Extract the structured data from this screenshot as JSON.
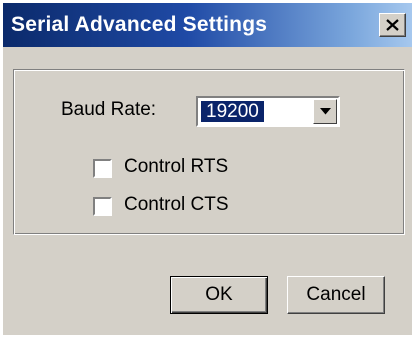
{
  "window": {
    "title": "Serial Advanced Settings",
    "close_glyph": "X"
  },
  "settings": {
    "baud_rate_label": "Baud Rate:",
    "baud_rate_value": "19200",
    "control_rts_label": "Control RTS",
    "control_rts_checked": false,
    "control_cts_label": "Control CTS",
    "control_cts_checked": false
  },
  "buttons": {
    "ok_label": "OK",
    "cancel_label": "Cancel"
  },
  "icons": {
    "close": "close-icon",
    "dropdown": "chevron-down-icon"
  }
}
